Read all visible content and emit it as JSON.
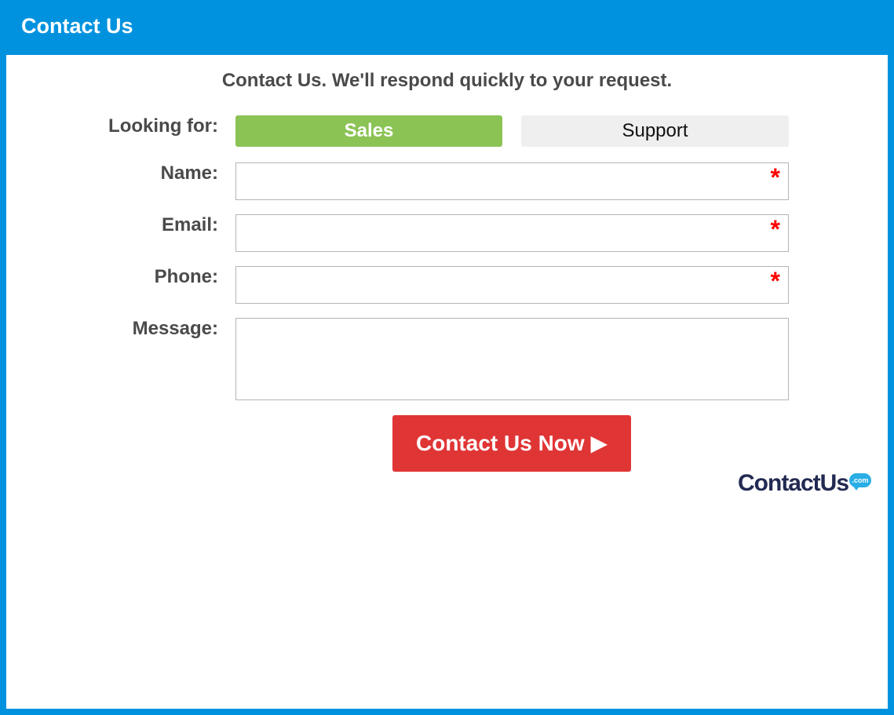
{
  "window": {
    "title": "Contact Us"
  },
  "form": {
    "subtitle": "Contact Us. We'll respond quickly to your request.",
    "looking_for": {
      "label": "Looking for:",
      "options": [
        "Sales",
        "Support"
      ],
      "selected": "Sales"
    },
    "fields": {
      "name": {
        "label": "Name:",
        "value": "",
        "required_mark": "*"
      },
      "email": {
        "label": "Email:",
        "value": "",
        "required_mark": "*"
      },
      "phone": {
        "label": "Phone:",
        "value": "",
        "required_mark": "*"
      },
      "message": {
        "label": "Message:",
        "value": ""
      }
    },
    "submit_label": "Contact Us Now ▶"
  },
  "branding": {
    "logo_text": "ContactUs",
    "logo_badge": ".com"
  },
  "colors": {
    "accent_blue": "#0092df",
    "selected_green": "#8bc355",
    "submit_red": "#e03535",
    "required_red": "#ff0000",
    "unselected_gray": "#efefef"
  }
}
